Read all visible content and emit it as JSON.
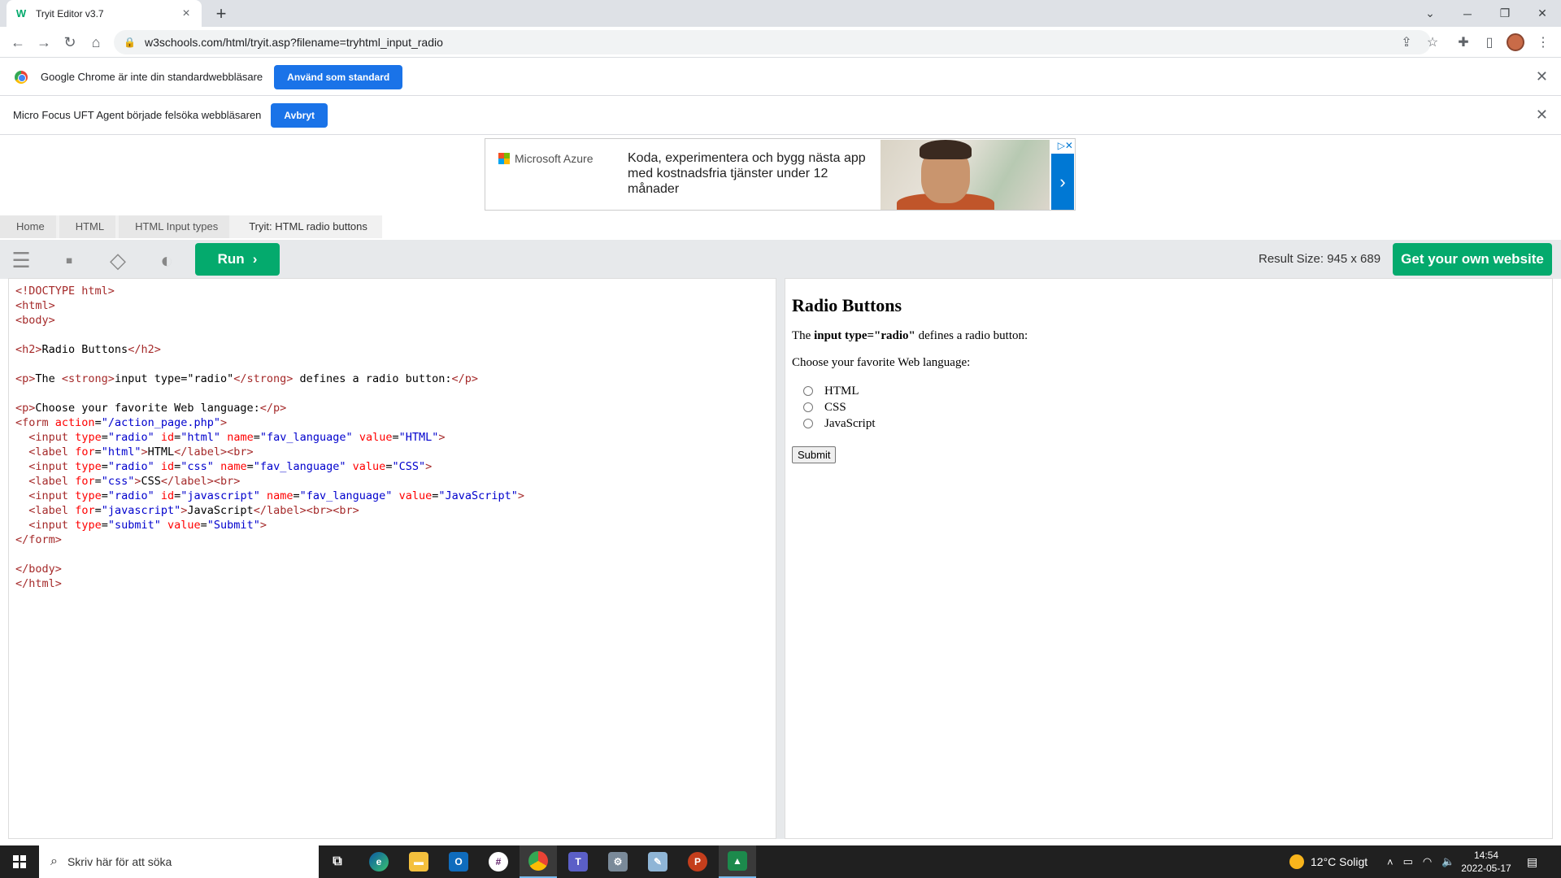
{
  "browser": {
    "tab_title": "Tryit Editor v3.7",
    "tab_close": "×",
    "new_tab": "+",
    "url": "w3schools.com/html/tryit.asp?filename=tryhtml_input_radio"
  },
  "infobars": [
    {
      "text": "Google Chrome är inte din standardwebbläsare",
      "button": "Använd som standard"
    },
    {
      "text": "Micro Focus UFT Agent började felsöka webbläsaren",
      "button": "Avbryt"
    }
  ],
  "ad": {
    "brand": "Microsoft Azure",
    "text": "Koda, experimentera och bygg nästa app med kostnadsfria tjänster under 12 månader",
    "arrow": "›"
  },
  "breadcrumb": [
    "Home",
    "HTML",
    "HTML Input types",
    "Tryit: HTML radio buttons"
  ],
  "editor": {
    "run_label": "Run",
    "result_size": "Result Size: 945 x 689",
    "own_site_label": "Get your own website"
  },
  "result": {
    "heading": "Radio Buttons",
    "intro_pre": "The ",
    "intro_strong": "input type=\"radio\"",
    "intro_post": " defines a radio button:",
    "choose": "Choose your favorite Web language:",
    "options": [
      "HTML",
      "CSS",
      "JavaScript"
    ],
    "submit": "Submit"
  },
  "taskbar": {
    "search_placeholder": "Skriv här för att söka",
    "weather": "12°C  Soligt",
    "time": "14:54",
    "date": "2022-05-17"
  }
}
